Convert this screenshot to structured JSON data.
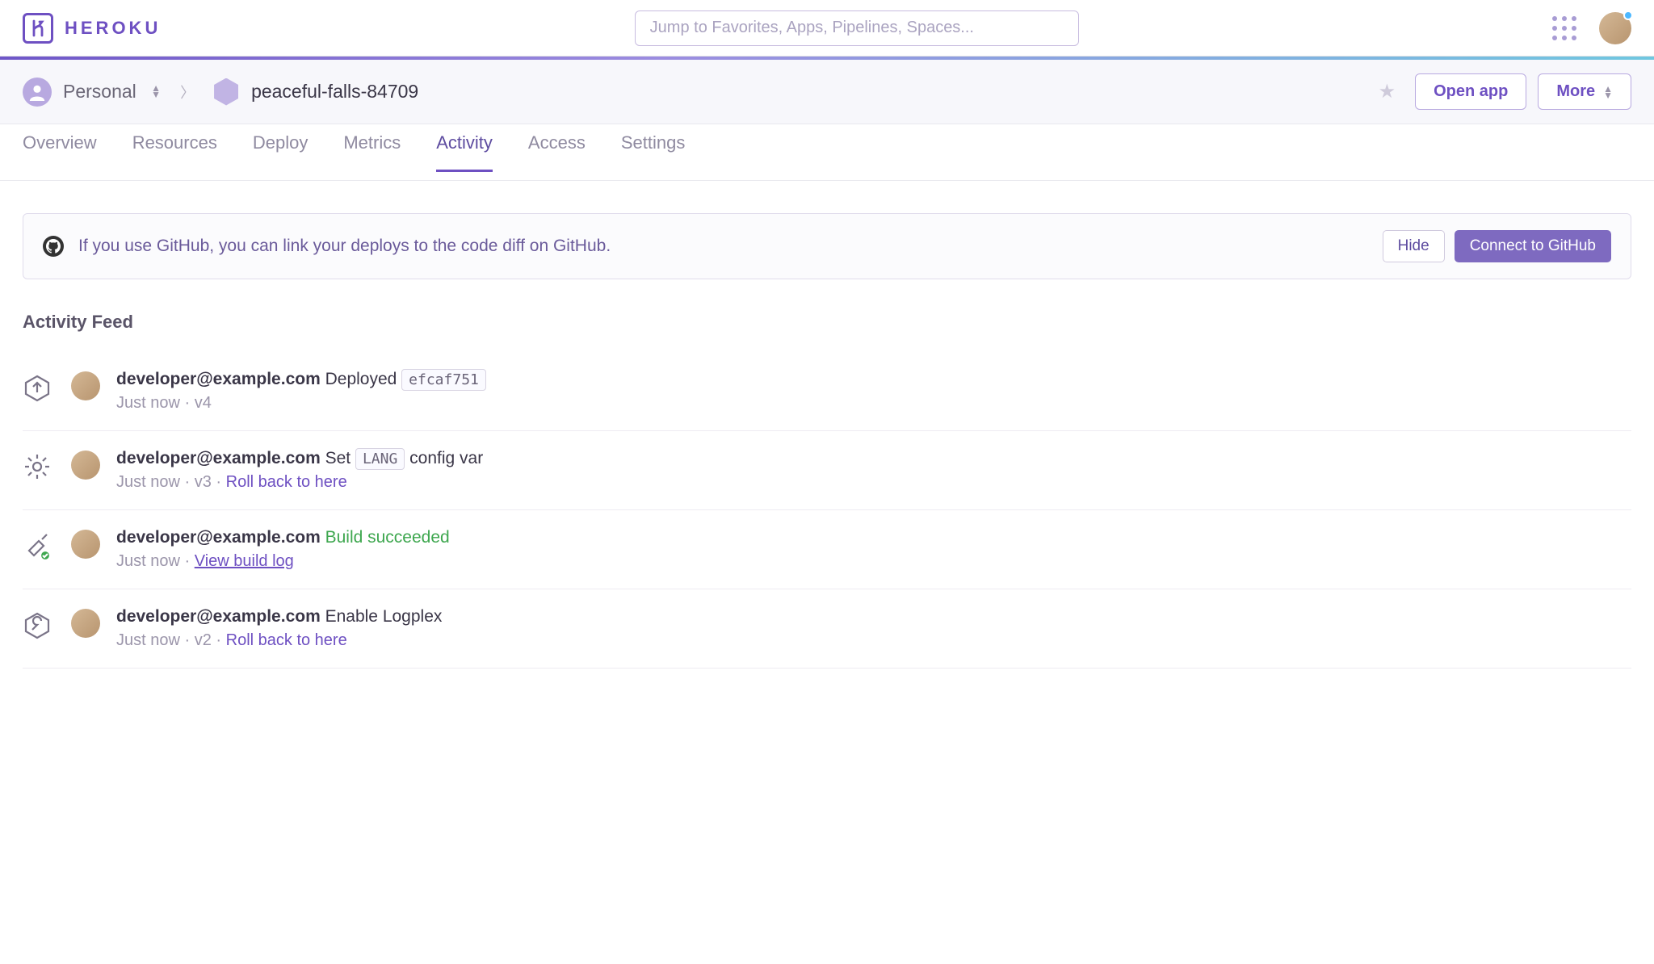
{
  "brand": "HEROKU",
  "search": {
    "placeholder": "Jump to Favorites, Apps, Pipelines, Spaces..."
  },
  "breadcrumb": {
    "team": "Personal",
    "app": "peaceful-falls-84709",
    "open_app": "Open app",
    "more": "More"
  },
  "tabs": {
    "overview": "Overview",
    "resources": "Resources",
    "deploy": "Deploy",
    "metrics": "Metrics",
    "activity": "Activity",
    "access": "Access",
    "settings": "Settings"
  },
  "banner": {
    "text": "If you use GitHub, you can link your deploys to the code diff on GitHub.",
    "hide": "Hide",
    "connect": "Connect to GitHub"
  },
  "feed": {
    "heading": "Activity Feed",
    "items": [
      {
        "user": "developer@example.com",
        "action": "Deployed",
        "chip": "efcaf751",
        "time": "Just now",
        "version": "v4",
        "icon": "deploy"
      },
      {
        "user": "developer@example.com",
        "action": "Set",
        "chip": "LANG",
        "suffix": "config var",
        "time": "Just now",
        "version": "v3",
        "rollback": "Roll back to here",
        "icon": "gear"
      },
      {
        "user": "developer@example.com",
        "status": "Build succeeded",
        "time": "Just now",
        "loglink": "View build log",
        "icon": "build"
      },
      {
        "user": "developer@example.com",
        "action": "Enable Logplex",
        "time": "Just now",
        "version": "v2",
        "rollback": "Roll back to here",
        "icon": "wrench"
      }
    ]
  }
}
